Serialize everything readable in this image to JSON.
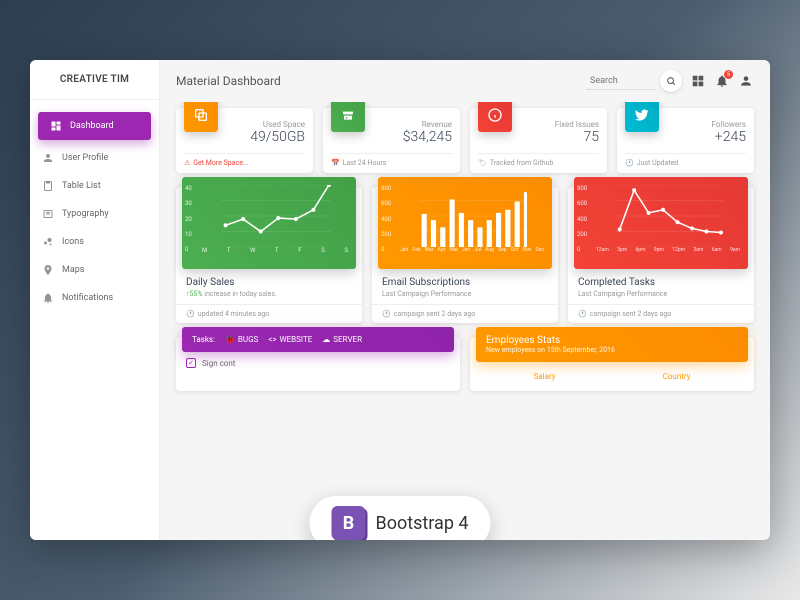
{
  "brand": "CREATIVE TIM",
  "page_title": "Material Dashboard",
  "search": {
    "placeholder": "Search"
  },
  "notification_count": "5",
  "sidebar": {
    "items": [
      {
        "label": "Dashboard"
      },
      {
        "label": "User Profile"
      },
      {
        "label": "Table List"
      },
      {
        "label": "Typography"
      },
      {
        "label": "Icons"
      },
      {
        "label": "Maps"
      },
      {
        "label": "Notifications"
      }
    ]
  },
  "stats": [
    {
      "label": "Used Space",
      "value": "49/50GB",
      "footer": "Get More Space..."
    },
    {
      "label": "Revenue",
      "value": "$34,245",
      "footer": "Last 24 Hours"
    },
    {
      "label": "Fixed Issues",
      "value": "75",
      "footer": "Tracked from Github"
    },
    {
      "label": "Followers",
      "value": "+245",
      "footer": "Just Updated"
    }
  ],
  "charts": [
    {
      "title": "Daily Sales",
      "sub_pct": "↑55%",
      "sub_rest": " increase in today sales.",
      "footer": "updated 4 minutes ago"
    },
    {
      "title": "Email Subscriptions",
      "sub": "Last Campaign Performance",
      "footer": "campaign sent 2 days ago"
    },
    {
      "title": "Completed Tasks",
      "sub": "Last Campaign Performance",
      "footer": "campaign sent 2 days ago"
    }
  ],
  "tasks": {
    "header": "Tasks:",
    "tabs": [
      "BUGS",
      "WEBSITE",
      "SERVER"
    ],
    "row": "Sign cont"
  },
  "employees": {
    "title": "Employees Stats",
    "sub": "New employees on 15th September, 2016",
    "cols": [
      "Salary",
      "Country"
    ]
  },
  "bootstrap": "Bootstrap 4",
  "chart_data": [
    {
      "type": "line",
      "title": "Daily Sales",
      "categories": [
        "M",
        "T",
        "W",
        "T",
        "F",
        "S",
        "S"
      ],
      "values": [
        14,
        18,
        10,
        19,
        18,
        24,
        40
      ],
      "ylim": [
        0,
        40
      ],
      "yticks": [
        0,
        10,
        20,
        30,
        40
      ]
    },
    {
      "type": "bar",
      "title": "Email Subscriptions",
      "categories": [
        "Jan",
        "Feb",
        "Mar",
        "Apr",
        "Mai",
        "Jun",
        "Jul",
        "Aug",
        "Sep",
        "Oct",
        "Nov",
        "Dec"
      ],
      "values": [
        530,
        440,
        310,
        770,
        550,
        440,
        310,
        440,
        550,
        600,
        740,
        880
      ],
      "ylim": [
        0,
        1000
      ],
      "yticks": [
        0,
        200,
        400,
        600,
        800
      ]
    },
    {
      "type": "line",
      "title": "Completed Tasks",
      "categories": [
        "12am",
        "3pm",
        "6pm",
        "9pm",
        "12pm",
        "3am",
        "6am",
        "9am"
      ],
      "values": [
        220,
        740,
        440,
        480,
        320,
        240,
        200,
        190
      ],
      "ylim": [
        0,
        800
      ],
      "yticks": [
        0,
        200,
        400,
        600,
        800
      ]
    }
  ]
}
